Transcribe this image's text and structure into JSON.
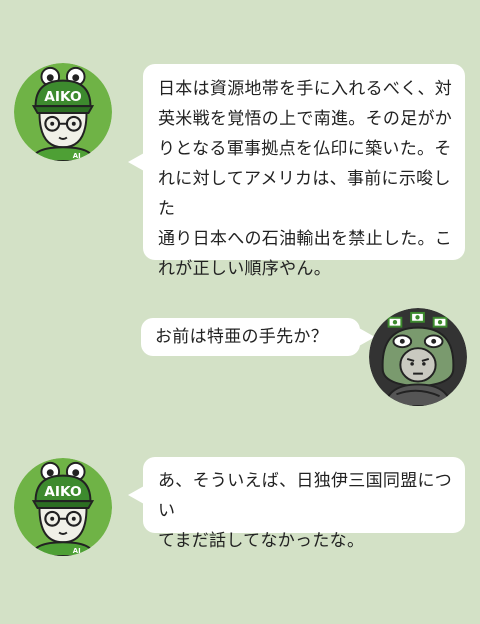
{
  "conversation": [
    {
      "speaker_icon": "aiko-avatar",
      "side": "left",
      "text": "日本は資源地帯を手に入れるべく、対\n英米戦を覚悟の上で南進。その足がか\nりとなる軍事拠点を仏印に築いた。そ\nれに対してアメリカは、事前に示唆した\n通り日本への石油輸出を禁止した。こ\nれが正しい順序やん。"
    },
    {
      "speaker_icon": "frog-avatar",
      "side": "right",
      "text": "お前は特亜の手先か？"
    },
    {
      "speaker_icon": "aiko-avatar",
      "side": "left",
      "text": "あ、そういえば、日独伊三国同盟につい\nてまだ話してなかったな。"
    }
  ],
  "aiko": {
    "cap_text": "AIKO",
    "badge_text": "AI"
  },
  "colors": {
    "background": "#d3e1c6",
    "aiko_circle": "#6fb346",
    "frog_circle": "#333333",
    "bubble": "#ffffff"
  }
}
